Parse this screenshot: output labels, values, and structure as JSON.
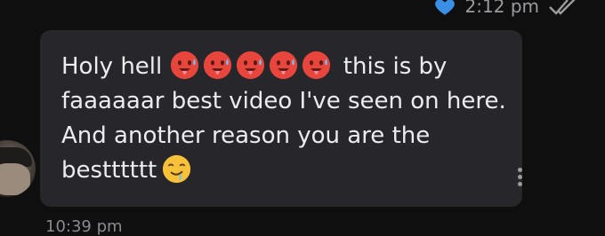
{
  "previous_message": {
    "time": "2:12 pm"
  },
  "message": {
    "part1": "Holy hell",
    "emoji_hot": [
      "hot-face",
      "hot-face",
      "hot-face",
      "hot-face",
      "hot-face"
    ],
    "part2": " this is by faaaaaar best video I've seen on here. And another reason you are the bestttttt",
    "emoji_end": "drooling-face"
  },
  "next_message": {
    "time": "10:39 pm"
  },
  "colors": {
    "background": "#0f0f10",
    "bubble": "#27272b",
    "text": "#ececee",
    "heart": "#3a8ee6",
    "meta": "#9b9ba0"
  }
}
